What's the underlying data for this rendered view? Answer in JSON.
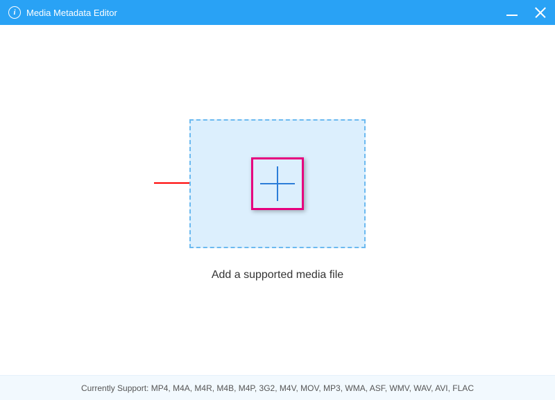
{
  "titlebar": {
    "title": "Media Metadata Editor",
    "info_icon_label": "i"
  },
  "main": {
    "instruction": "Add a supported media file"
  },
  "footer": {
    "support_text": "Currently Support: MP4, M4A, M4R, M4B, M4P, 3G2, M4V, MOV, MP3, WMA, ASF, WMV, WAV, AVI, FLAC"
  }
}
